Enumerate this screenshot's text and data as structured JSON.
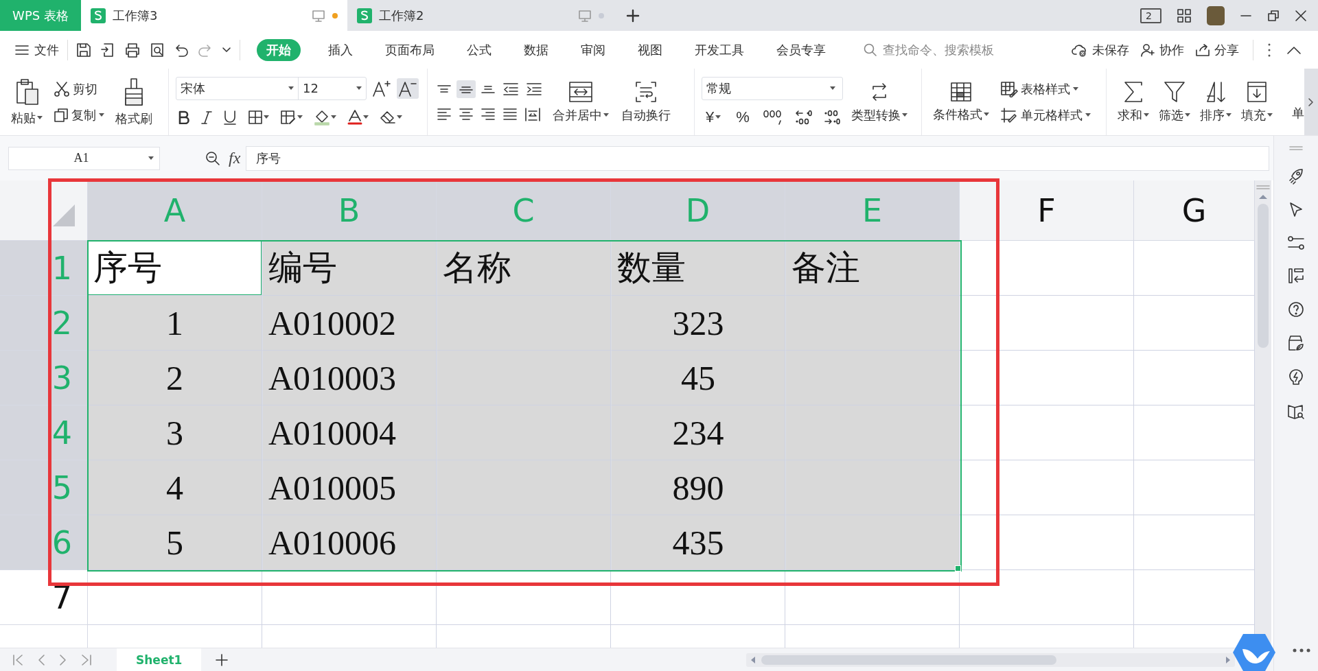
{
  "app_tabs": [
    {
      "label": "WPS 表格",
      "kind": "home"
    },
    {
      "label": "工作簿3",
      "kind": "doc",
      "selected": true,
      "modified": true
    },
    {
      "label": "工作簿2",
      "kind": "doc",
      "selected": false,
      "modified": false
    }
  ],
  "window_badge": "2",
  "menu": {
    "file": "文件",
    "tabs": [
      {
        "label": "开始",
        "selected": true
      },
      {
        "label": "插入",
        "selected": false
      },
      {
        "label": "页面布局",
        "selected": false
      },
      {
        "label": "公式",
        "selected": false
      },
      {
        "label": "数据",
        "selected": false
      },
      {
        "label": "审阅",
        "selected": false
      },
      {
        "label": "视图",
        "selected": false
      },
      {
        "label": "开发工具",
        "selected": false
      },
      {
        "label": "会员专享",
        "selected": false
      }
    ],
    "search": {
      "placeholder": "查找命令、搜索模板"
    },
    "save_status": "未保存",
    "collaborate": "协作",
    "share": "分享"
  },
  "ribbon": {
    "paste": "粘贴",
    "cut": "剪切",
    "copy": "复制",
    "format_painter": "格式刷",
    "font_name": "宋体",
    "font_size": "12",
    "font_size_buttons": [
      {
        "kind": "grow",
        "selected": false
      },
      {
        "kind": "shrink",
        "selected": true
      }
    ],
    "align_buttons": [
      {
        "kind": "top",
        "selected": false
      },
      {
        "kind": "middle",
        "selected": true
      },
      {
        "kind": "bottom",
        "selected": false
      },
      {
        "kind": "outdent",
        "selected": false
      },
      {
        "kind": "indent",
        "selected": false
      },
      {
        "kind": "left",
        "selected": false
      },
      {
        "kind": "center",
        "selected": false
      },
      {
        "kind": "right",
        "selected": false
      },
      {
        "kind": "justify",
        "selected": false
      },
      {
        "kind": "distributed",
        "selected": false
      }
    ],
    "merge_center": "合并居中",
    "wrap_text": "自动换行",
    "number_format": "常规",
    "currency": "¥",
    "percent": "%",
    "convert_type": "类型转换",
    "conditional_format": "条件格式",
    "table_style": "表格样式",
    "cell_style": "单元格样式",
    "sum": "求和",
    "filter": "筛选",
    "sort": "排序",
    "fill": "填充",
    "more": "单"
  },
  "formula_bar": {
    "name_box": "A1",
    "fx": "fx",
    "formula": "序号"
  },
  "sheet": {
    "columns": [
      {
        "label": "A",
        "selected": true
      },
      {
        "label": "B",
        "selected": true
      },
      {
        "label": "C",
        "selected": true
      },
      {
        "label": "D",
        "selected": true
      },
      {
        "label": "E",
        "selected": true
      },
      {
        "label": "F",
        "selected": false
      },
      {
        "label": "G",
        "selected": false
      }
    ],
    "rows": [
      {
        "label": "1",
        "selected": true,
        "cells": [
          {
            "text": "序号",
            "active": true
          },
          {
            "text": "编号",
            "active": false
          },
          {
            "text": "名称",
            "active": false
          },
          {
            "text": "数量",
            "active": false
          },
          {
            "text": "备注",
            "active": false
          }
        ]
      },
      {
        "label": "2",
        "selected": true,
        "cells": [
          {
            "text": "1",
            "active": false
          },
          {
            "text": "A010002",
            "active": false
          },
          {
            "active": false
          },
          {
            "text": "323",
            "active": false
          },
          {
            "active": false
          }
        ]
      },
      {
        "label": "3",
        "selected": true,
        "cells": [
          {
            "text": "2",
            "active": false
          },
          {
            "text": "A010003",
            "active": false
          },
          {
            "active": false
          },
          {
            "text": "45",
            "active": false
          },
          {
            "active": false
          }
        ]
      },
      {
        "label": "4",
        "selected": true,
        "cells": [
          {
            "text": "3",
            "active": false
          },
          {
            "text": "A010004",
            "active": false
          },
          {
            "active": false
          },
          {
            "text": "234",
            "active": false
          },
          {
            "active": false
          }
        ]
      },
      {
        "label": "5",
        "selected": true,
        "cells": [
          {
            "text": "4",
            "active": false
          },
          {
            "text": "A010005",
            "active": false
          },
          {
            "active": false
          },
          {
            "text": "890",
            "active": false
          },
          {
            "active": false
          }
        ]
      },
      {
        "label": "6",
        "selected": true,
        "cells": [
          {
            "text": "5",
            "active": false
          },
          {
            "text": "A010006",
            "active": false
          },
          {
            "active": false
          },
          {
            "text": "435",
            "active": false
          },
          {
            "active": false
          }
        ]
      },
      {
        "label": "7",
        "selected": false
      },
      {
        "selected": false
      }
    ]
  },
  "sheet_tabs": [
    {
      "label": "Sheet1",
      "selected": true
    }
  ],
  "annotation": {
    "kind": "frame"
  }
}
